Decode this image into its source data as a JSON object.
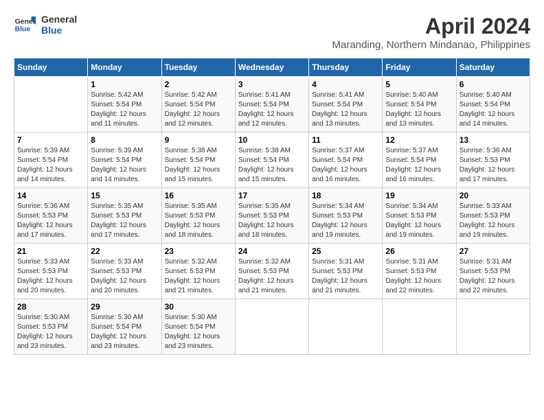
{
  "header": {
    "logo_line1": "General",
    "logo_line2": "Blue",
    "month": "April 2024",
    "location": "Maranding, Northern Mindanao, Philippines"
  },
  "weekdays": [
    "Sunday",
    "Monday",
    "Tuesday",
    "Wednesday",
    "Thursday",
    "Friday",
    "Saturday"
  ],
  "weeks": [
    [
      {
        "day": "",
        "sunrise": "",
        "sunset": "",
        "daylight": ""
      },
      {
        "day": "1",
        "sunrise": "Sunrise: 5:42 AM",
        "sunset": "Sunset: 5:54 PM",
        "daylight": "Daylight: 12 hours and 11 minutes."
      },
      {
        "day": "2",
        "sunrise": "Sunrise: 5:42 AM",
        "sunset": "Sunset: 5:54 PM",
        "daylight": "Daylight: 12 hours and 12 minutes."
      },
      {
        "day": "3",
        "sunrise": "Sunrise: 5:41 AM",
        "sunset": "Sunset: 5:54 PM",
        "daylight": "Daylight: 12 hours and 12 minutes."
      },
      {
        "day": "4",
        "sunrise": "Sunrise: 5:41 AM",
        "sunset": "Sunset: 5:54 PM",
        "daylight": "Daylight: 12 hours and 13 minutes."
      },
      {
        "day": "5",
        "sunrise": "Sunrise: 5:40 AM",
        "sunset": "Sunset: 5:54 PM",
        "daylight": "Daylight: 12 hours and 13 minutes."
      },
      {
        "day": "6",
        "sunrise": "Sunrise: 5:40 AM",
        "sunset": "Sunset: 5:54 PM",
        "daylight": "Daylight: 12 hours and 14 minutes."
      }
    ],
    [
      {
        "day": "7",
        "sunrise": "Sunrise: 5:39 AM",
        "sunset": "Sunset: 5:54 PM",
        "daylight": "Daylight: 12 hours and 14 minutes."
      },
      {
        "day": "8",
        "sunrise": "Sunrise: 5:39 AM",
        "sunset": "Sunset: 5:54 PM",
        "daylight": "Daylight: 12 hours and 14 minutes."
      },
      {
        "day": "9",
        "sunrise": "Sunrise: 5:38 AM",
        "sunset": "Sunset: 5:54 PM",
        "daylight": "Daylight: 12 hours and 15 minutes."
      },
      {
        "day": "10",
        "sunrise": "Sunrise: 5:38 AM",
        "sunset": "Sunset: 5:54 PM",
        "daylight": "Daylight: 12 hours and 15 minutes."
      },
      {
        "day": "11",
        "sunrise": "Sunrise: 5:37 AM",
        "sunset": "Sunset: 5:54 PM",
        "daylight": "Daylight: 12 hours and 16 minutes."
      },
      {
        "day": "12",
        "sunrise": "Sunrise: 5:37 AM",
        "sunset": "Sunset: 5:54 PM",
        "daylight": "Daylight: 12 hours and 16 minutes."
      },
      {
        "day": "13",
        "sunrise": "Sunrise: 5:36 AM",
        "sunset": "Sunset: 5:53 PM",
        "daylight": "Daylight: 12 hours and 17 minutes."
      }
    ],
    [
      {
        "day": "14",
        "sunrise": "Sunrise: 5:36 AM",
        "sunset": "Sunset: 5:53 PM",
        "daylight": "Daylight: 12 hours and 17 minutes."
      },
      {
        "day": "15",
        "sunrise": "Sunrise: 5:35 AM",
        "sunset": "Sunset: 5:53 PM",
        "daylight": "Daylight: 12 hours and 17 minutes."
      },
      {
        "day": "16",
        "sunrise": "Sunrise: 5:35 AM",
        "sunset": "Sunset: 5:53 PM",
        "daylight": "Daylight: 12 hours and 18 minutes."
      },
      {
        "day": "17",
        "sunrise": "Sunrise: 5:35 AM",
        "sunset": "Sunset: 5:53 PM",
        "daylight": "Daylight: 12 hours and 18 minutes."
      },
      {
        "day": "18",
        "sunrise": "Sunrise: 5:34 AM",
        "sunset": "Sunset: 5:53 PM",
        "daylight": "Daylight: 12 hours and 19 minutes."
      },
      {
        "day": "19",
        "sunrise": "Sunrise: 5:34 AM",
        "sunset": "Sunset: 5:53 PM",
        "daylight": "Daylight: 12 hours and 19 minutes."
      },
      {
        "day": "20",
        "sunrise": "Sunrise: 5:33 AM",
        "sunset": "Sunset: 5:53 PM",
        "daylight": "Daylight: 12 hours and 19 minutes."
      }
    ],
    [
      {
        "day": "21",
        "sunrise": "Sunrise: 5:33 AM",
        "sunset": "Sunset: 5:53 PM",
        "daylight": "Daylight: 12 hours and 20 minutes."
      },
      {
        "day": "22",
        "sunrise": "Sunrise: 5:33 AM",
        "sunset": "Sunset: 5:53 PM",
        "daylight": "Daylight: 12 hours and 20 minutes."
      },
      {
        "day": "23",
        "sunrise": "Sunrise: 5:32 AM",
        "sunset": "Sunset: 5:53 PM",
        "daylight": "Daylight: 12 hours and 21 minutes."
      },
      {
        "day": "24",
        "sunrise": "Sunrise: 5:32 AM",
        "sunset": "Sunset: 5:53 PM",
        "daylight": "Daylight: 12 hours and 21 minutes."
      },
      {
        "day": "25",
        "sunrise": "Sunrise: 5:31 AM",
        "sunset": "Sunset: 5:53 PM",
        "daylight": "Daylight: 12 hours and 21 minutes."
      },
      {
        "day": "26",
        "sunrise": "Sunrise: 5:31 AM",
        "sunset": "Sunset: 5:53 PM",
        "daylight": "Daylight: 12 hours and 22 minutes."
      },
      {
        "day": "27",
        "sunrise": "Sunrise: 5:31 AM",
        "sunset": "Sunset: 5:53 PM",
        "daylight": "Daylight: 12 hours and 22 minutes."
      }
    ],
    [
      {
        "day": "28",
        "sunrise": "Sunrise: 5:30 AM",
        "sunset": "Sunset: 5:53 PM",
        "daylight": "Daylight: 12 hours and 23 minutes."
      },
      {
        "day": "29",
        "sunrise": "Sunrise: 5:30 AM",
        "sunset": "Sunset: 5:54 PM",
        "daylight": "Daylight: 12 hours and 23 minutes."
      },
      {
        "day": "30",
        "sunrise": "Sunrise: 5:30 AM",
        "sunset": "Sunset: 5:54 PM",
        "daylight": "Daylight: 12 hours and 23 minutes."
      },
      {
        "day": "",
        "sunrise": "",
        "sunset": "",
        "daylight": ""
      },
      {
        "day": "",
        "sunrise": "",
        "sunset": "",
        "daylight": ""
      },
      {
        "day": "",
        "sunrise": "",
        "sunset": "",
        "daylight": ""
      },
      {
        "day": "",
        "sunrise": "",
        "sunset": "",
        "daylight": ""
      }
    ]
  ]
}
